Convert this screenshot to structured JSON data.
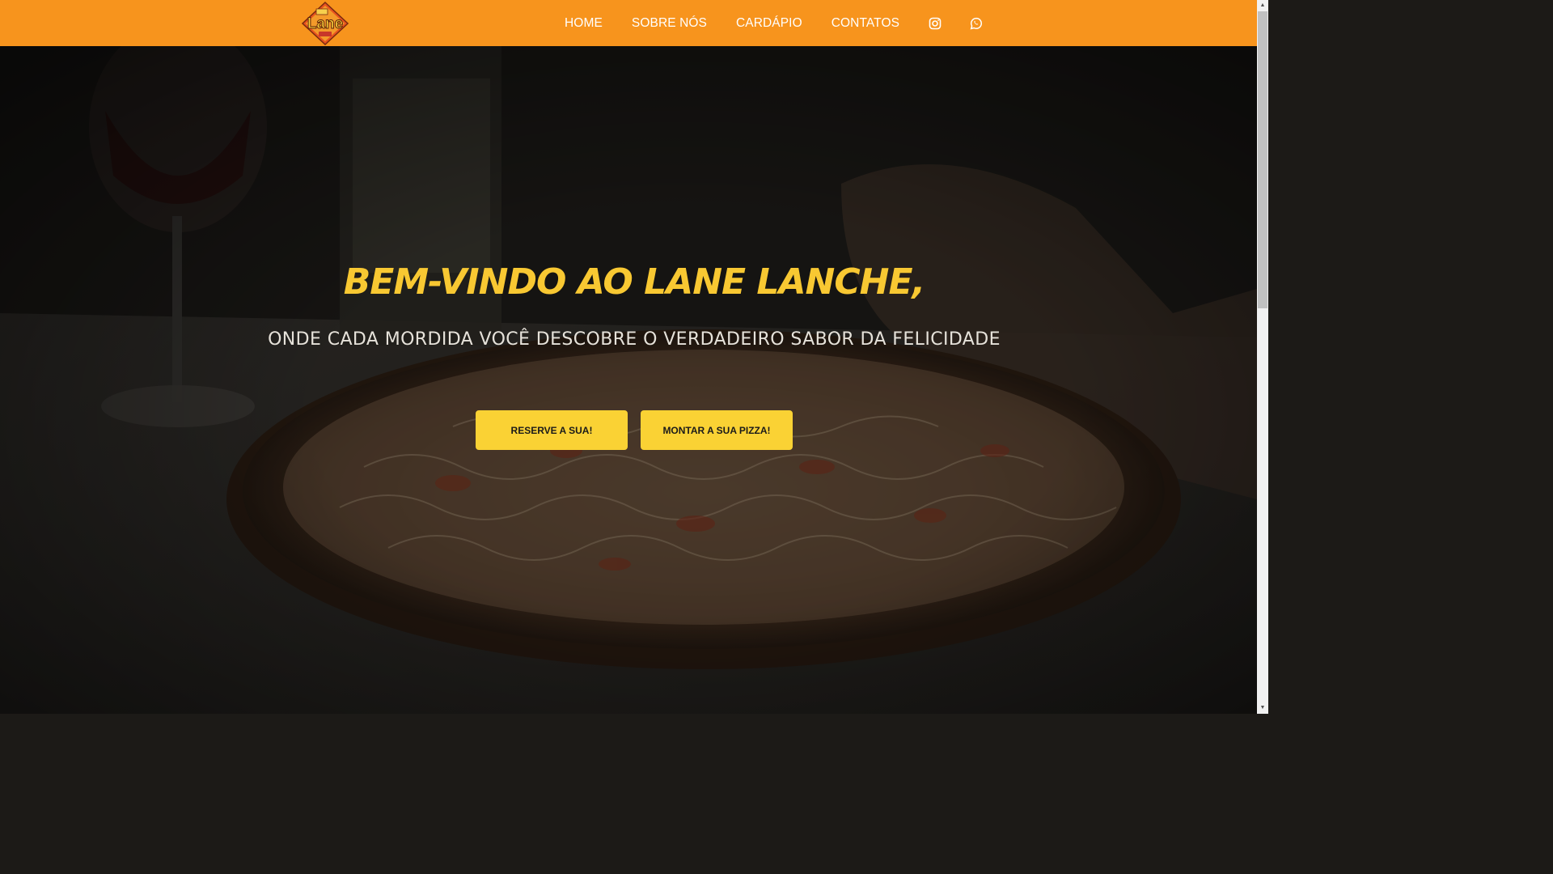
{
  "header": {
    "logo_text": "Lane",
    "nav": [
      {
        "label": "HOME"
      },
      {
        "label": "SOBRE NÓS"
      },
      {
        "label": "CARDÁPIO"
      },
      {
        "label": "CONTATOS"
      }
    ],
    "icons": [
      "instagram-icon",
      "whatsapp-icon"
    ]
  },
  "hero": {
    "title": "Bem-vindo ao Lane Lanche,",
    "subtitle": "onde cada mordida você descobre o verdadeiro sabor da felicidade",
    "buttons": {
      "reserve": "RESERVE A SUA!",
      "build_pizza": "MONTAR A SUA PIZZA!"
    }
  },
  "colors": {
    "header_bg": "#f7941d",
    "accent_yellow": "#fad234",
    "title_yellow": "#f8c832"
  }
}
